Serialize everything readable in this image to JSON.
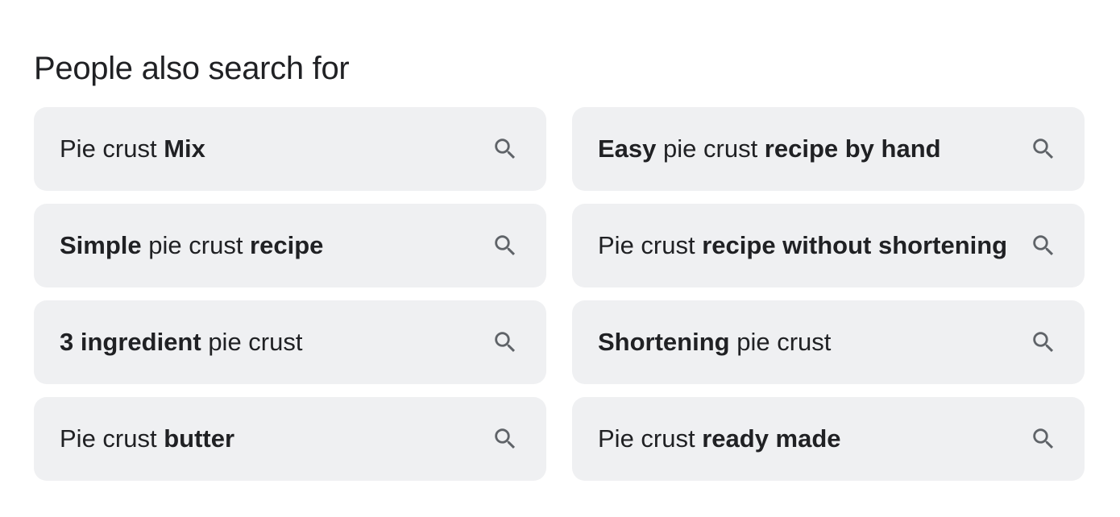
{
  "section": {
    "title": "People also search for"
  },
  "suggestions": [
    {
      "parts": [
        {
          "text": "Pie crust ",
          "bold": false
        },
        {
          "text": "Mix",
          "bold": true
        }
      ],
      "icon": "search-icon"
    },
    {
      "parts": [
        {
          "text": "Easy",
          "bold": true
        },
        {
          "text": " pie crust ",
          "bold": false
        },
        {
          "text": "recipe by hand",
          "bold": true
        }
      ],
      "icon": "search-icon"
    },
    {
      "parts": [
        {
          "text": "Simple",
          "bold": true
        },
        {
          "text": " pie crust ",
          "bold": false
        },
        {
          "text": "recipe",
          "bold": true
        }
      ],
      "icon": "search-icon"
    },
    {
      "parts": [
        {
          "text": "Pie crust ",
          "bold": false
        },
        {
          "text": "recipe without shortening",
          "bold": true
        }
      ],
      "icon": "search-icon"
    },
    {
      "parts": [
        {
          "text": "3 ingredient",
          "bold": true
        },
        {
          "text": " pie crust",
          "bold": false
        }
      ],
      "icon": "search-icon"
    },
    {
      "parts": [
        {
          "text": "Shortening",
          "bold": true
        },
        {
          "text": " pie crust",
          "bold": false
        }
      ],
      "icon": "search-icon"
    },
    {
      "parts": [
        {
          "text": "Pie crust ",
          "bold": false
        },
        {
          "text": "butter",
          "bold": true
        }
      ],
      "icon": "search-icon"
    },
    {
      "parts": [
        {
          "text": "Pie crust ",
          "bold": false
        },
        {
          "text": "ready made",
          "bold": true
        }
      ],
      "icon": "search-icon"
    }
  ],
  "colors": {
    "chip_background": "#eff0f2",
    "text": "#202124",
    "icon": "#5f6368"
  }
}
